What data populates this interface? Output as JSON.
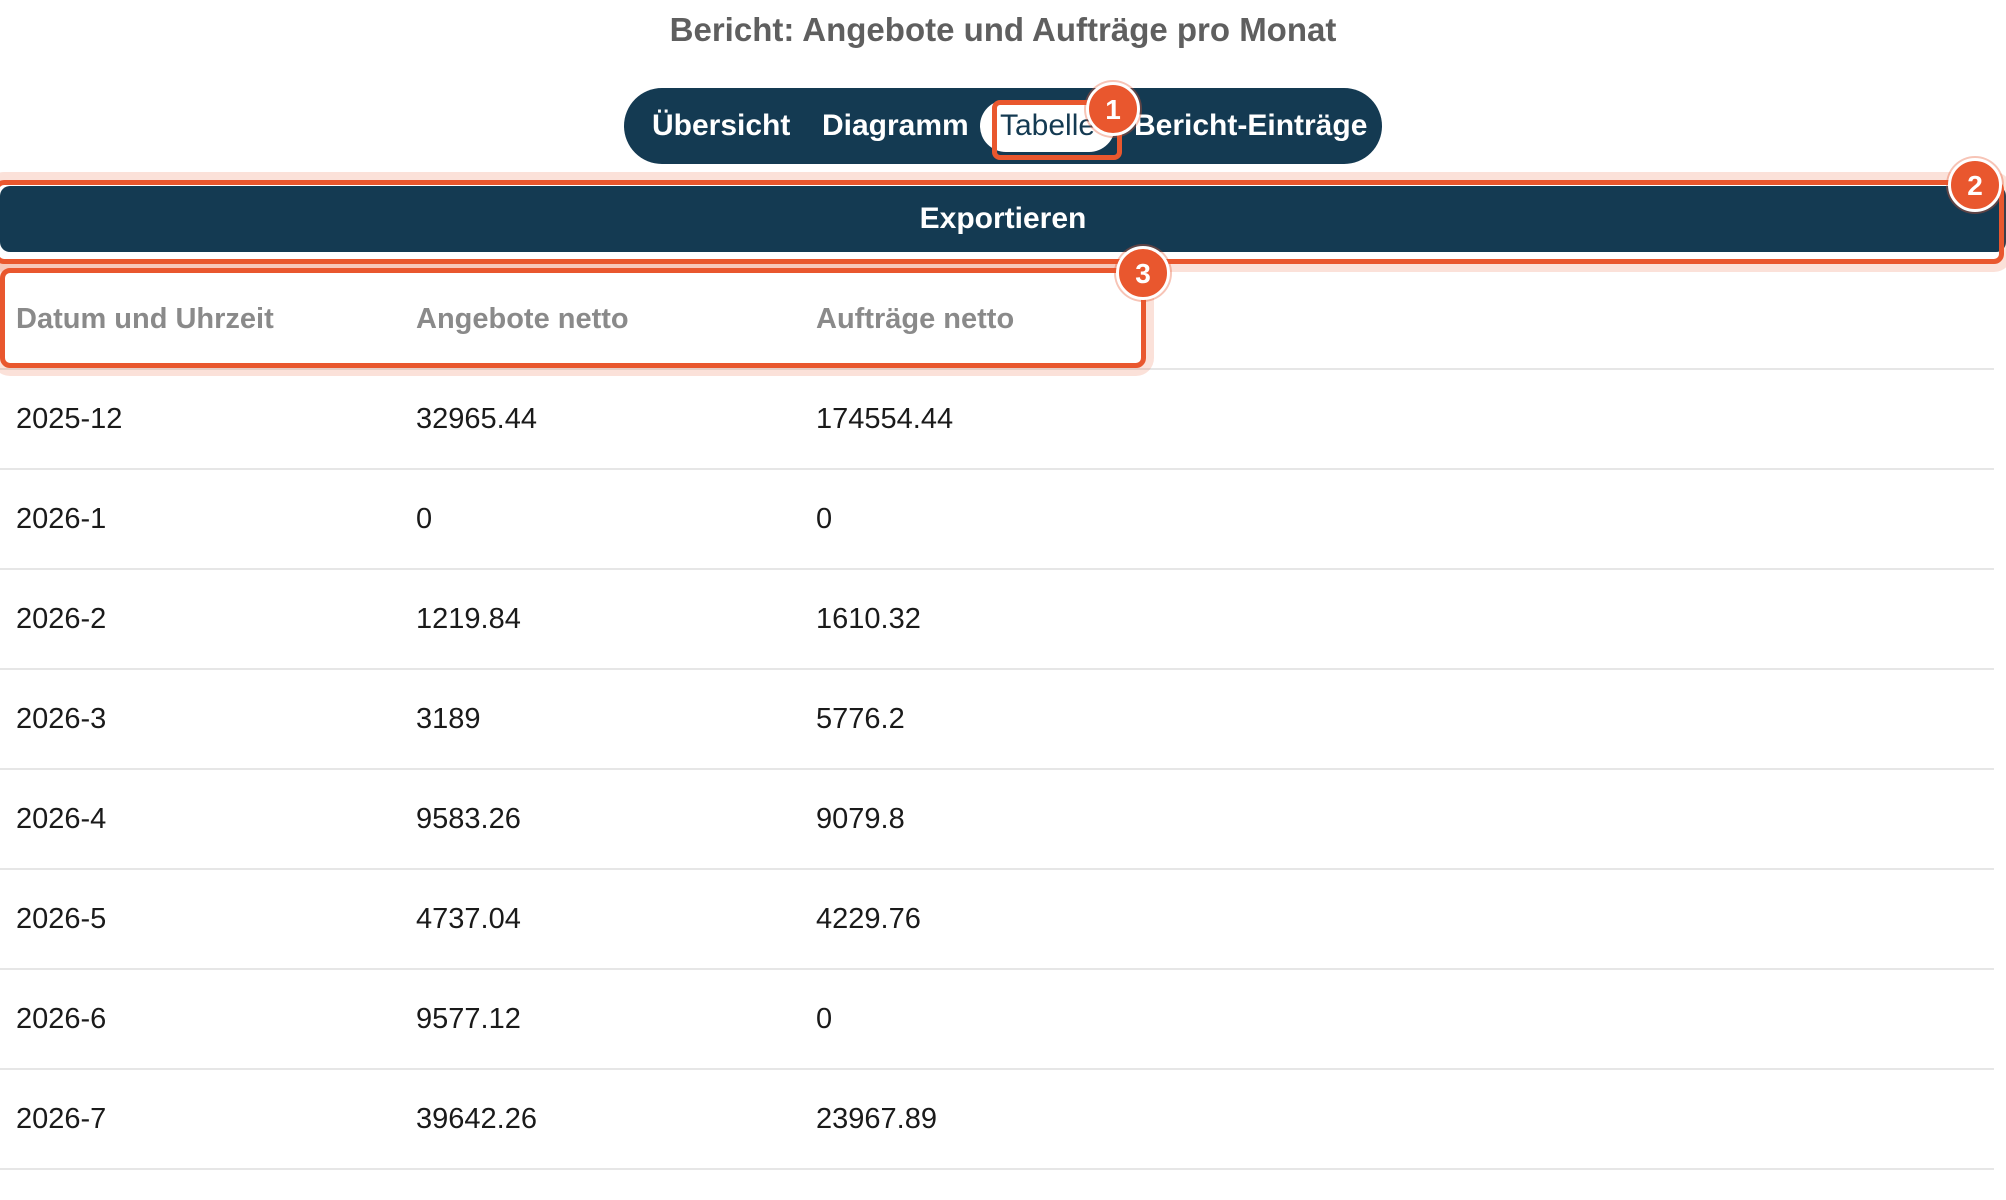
{
  "page": {
    "title": "Bericht: Angebote und Aufträge pro Monat"
  },
  "tabs": [
    {
      "label": "Übersicht",
      "active": false
    },
    {
      "label": "Diagramm",
      "active": false
    },
    {
      "label": "Tabelle",
      "active": true
    },
    {
      "label": "Bericht-Einträge",
      "active": false
    }
  ],
  "toolbar": {
    "export_label": "Exportieren"
  },
  "annotations": {
    "badge_1": "1",
    "badge_2": "2",
    "badge_3": "3"
  },
  "table": {
    "columns": [
      "Datum und Uhrzeit",
      "Angebote netto",
      "Aufträge netto"
    ],
    "rows": [
      [
        "2025-12",
        "32965.44",
        "174554.44"
      ],
      [
        "2026-1",
        "0",
        "0"
      ],
      [
        "2026-2",
        "1219.84",
        "1610.32"
      ],
      [
        "2026-3",
        "3189",
        "5776.2"
      ],
      [
        "2026-4",
        "9583.26",
        "9079.8"
      ],
      [
        "2026-5",
        "4737.04",
        "4229.76"
      ],
      [
        "2026-6",
        "9577.12",
        "0"
      ],
      [
        "2026-7",
        "39642.26",
        "23967.89"
      ]
    ]
  },
  "colors": {
    "primary": "#143a52",
    "highlight": "#e9572e",
    "title_text": "#5f5f5f",
    "header_text": "#8a8a8a",
    "row_divider": "#e6e6e6"
  }
}
